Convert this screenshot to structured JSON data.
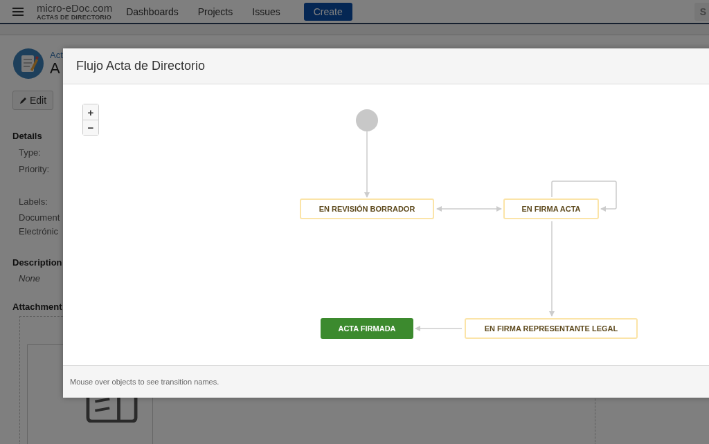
{
  "header": {
    "logo_top": "micro-eDoc.com",
    "logo_bottom": "ACTAS DE DIRECTORIO",
    "nav": [
      "Dashboards",
      "Projects",
      "Issues"
    ],
    "create_button": "Create",
    "right_button": "S"
  },
  "issue": {
    "breadcrumb": "Act",
    "title": "A",
    "edit_button": "Edit",
    "details_heading": "Details",
    "fields": [
      "Type:",
      "Priority:",
      "Labels:"
    ],
    "label_value": [
      "Document",
      "Electrónic"
    ],
    "description_heading": "Description",
    "description": "None",
    "attachments_heading": "Attachment"
  },
  "dialog": {
    "title": "Flujo Acta de Directorio",
    "zoom_in": "+",
    "zoom_out": "−",
    "nodes": [
      {
        "kind": "start"
      },
      {
        "kind": "status",
        "label": "EN REVISIÓN BORRADOR"
      },
      {
        "kind": "status",
        "label": "EN FIRMA ACTA"
      },
      {
        "kind": "done",
        "label": "ACTA FIRMADA"
      },
      {
        "kind": "status",
        "label": "EN FIRMA REPRESENTANTE LEGAL"
      }
    ],
    "footer": "Mouse over objects to see transition names."
  }
}
